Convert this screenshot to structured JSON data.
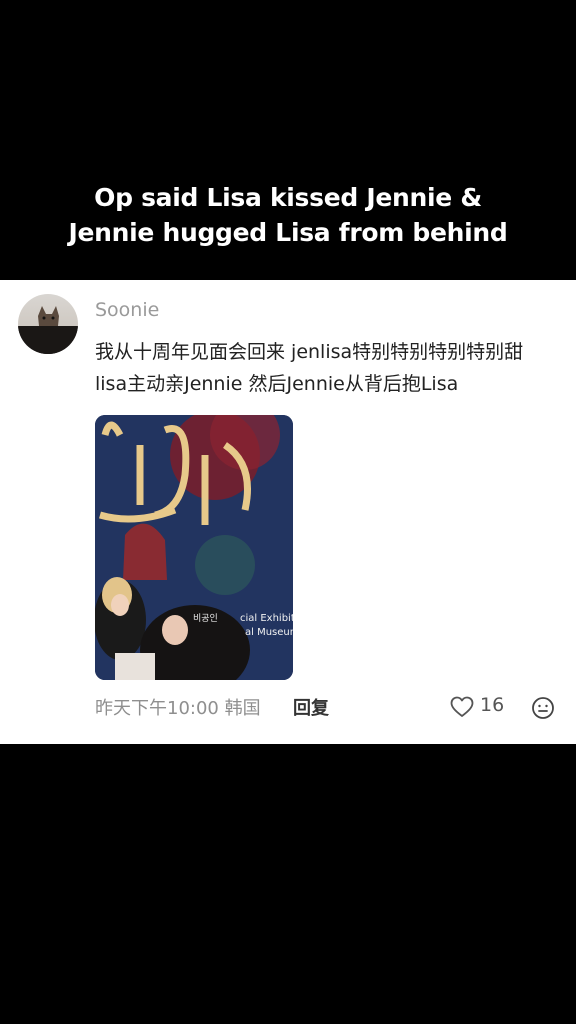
{
  "caption": {
    "line1": "Op said Lisa kissed Jennie &",
    "line2": "Jennie hugged Lisa from behind"
  },
  "comment": {
    "username": "Soonie",
    "text_line1": "我从十周年见面会回来 jenlisa特别特别特别特别甜",
    "text_line2": "lisa主动亲Jennie 然后Jennie从背后抱Lisa",
    "photo": {
      "sign_text_1": "cial Exhibition",
      "sign_text_2": "al Museum",
      "sign_text_3": "비공인"
    },
    "timestamp": "昨天下午10:00 韩国",
    "reply_label": "回复",
    "like_count": "16"
  },
  "icons": {
    "like": "heart-outline-icon",
    "emoji": "smiley-face-icon"
  },
  "colors": {
    "background": "#000000",
    "card": "#ffffff",
    "caption_text": "#ffffff"
  }
}
